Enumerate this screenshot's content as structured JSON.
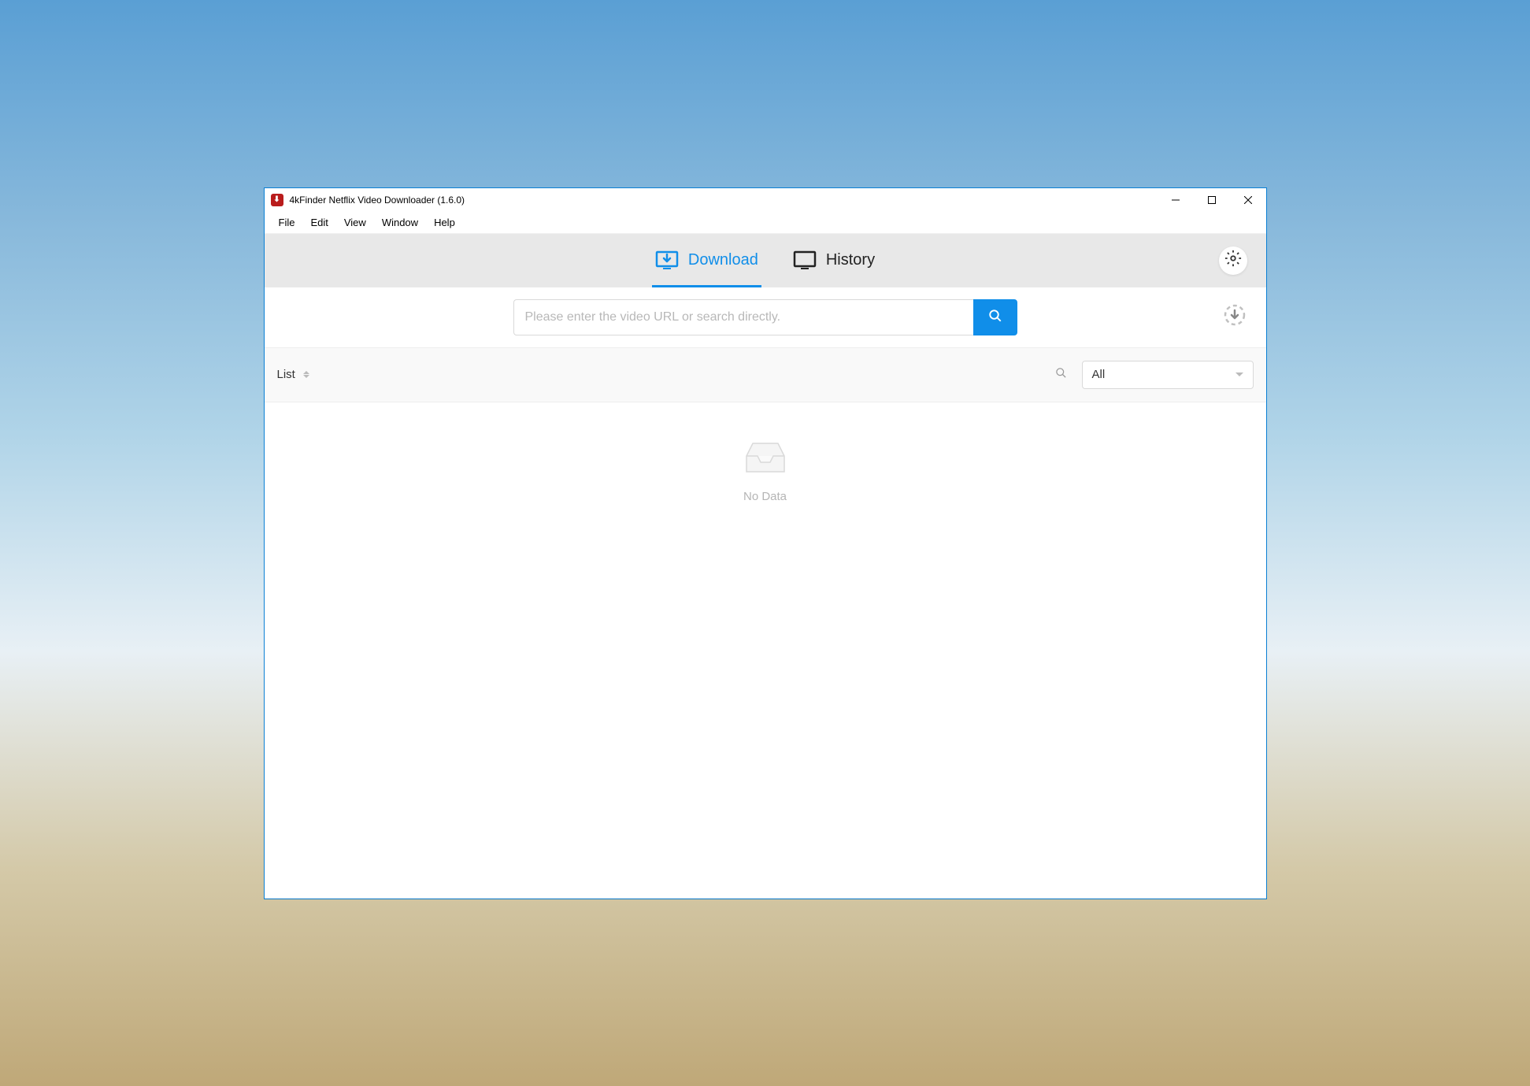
{
  "window": {
    "title": "4kFinder Netflix Video Downloader (1.6.0)"
  },
  "menubar": {
    "items": [
      "File",
      "Edit",
      "View",
      "Window",
      "Help"
    ]
  },
  "tabs": {
    "download": "Download",
    "history": "History"
  },
  "search": {
    "placeholder": "Please enter the video URL or search directly.",
    "value": ""
  },
  "list": {
    "label": "List",
    "filter_selected": "All",
    "empty_text": "No Data"
  }
}
